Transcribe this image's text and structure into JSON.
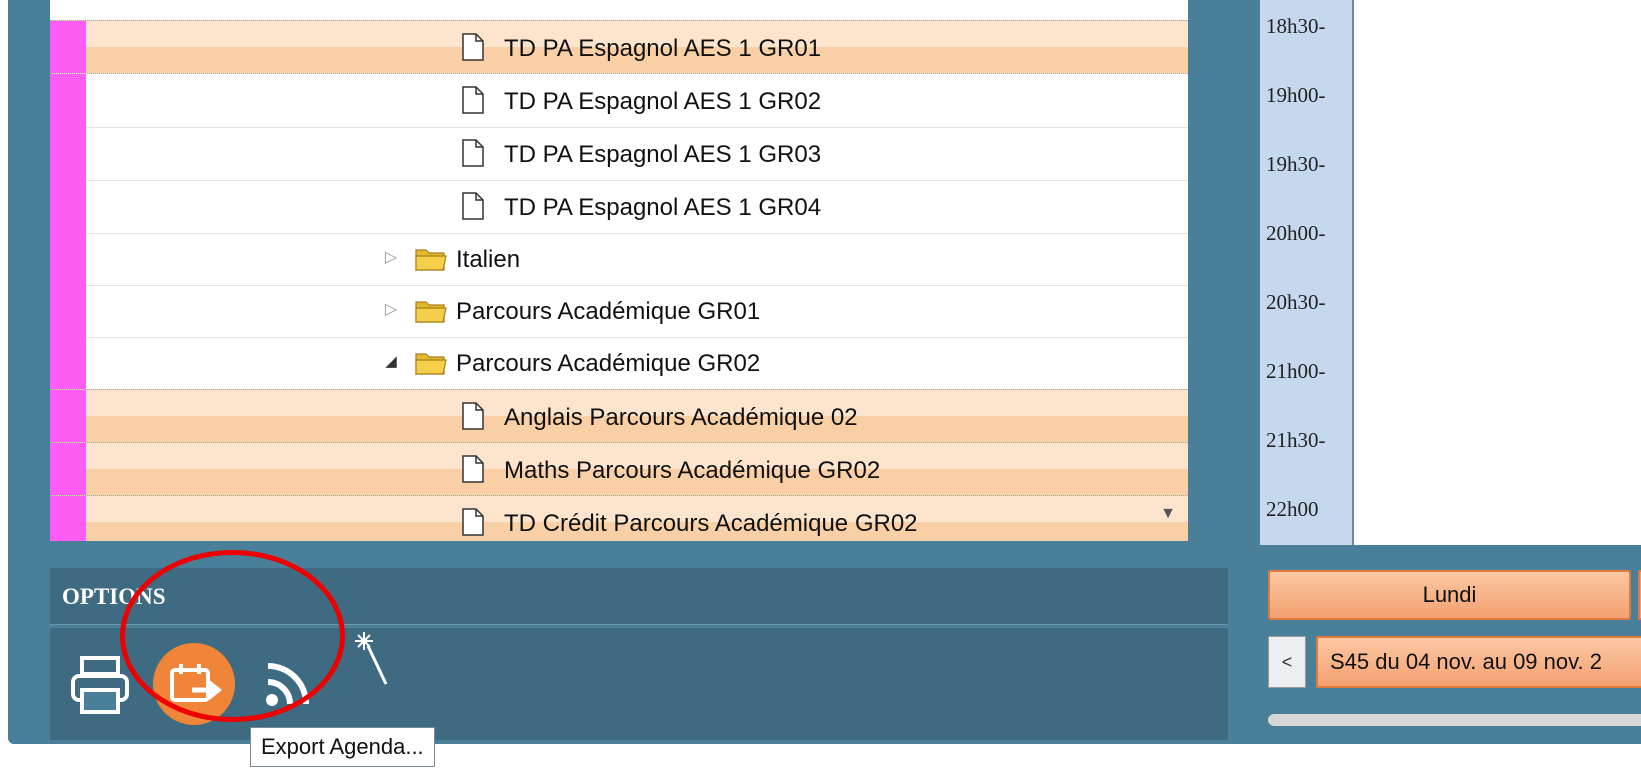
{
  "tree": {
    "rows": [
      {
        "label": "TD PA Espagnol AES 1 GR01",
        "type": "file",
        "selected": true
      },
      {
        "label": "TD PA Espagnol AES 1 GR02",
        "type": "file",
        "selected": false
      },
      {
        "label": "TD PA Espagnol AES 1 GR03",
        "type": "file",
        "selected": false
      },
      {
        "label": "TD PA Espagnol AES 1 GR04",
        "type": "file",
        "selected": false
      },
      {
        "label": "Italien",
        "type": "folder",
        "expanded": false
      },
      {
        "label": "Parcours Académique GR01",
        "type": "folder",
        "expanded": false
      },
      {
        "label": "Parcours Académique GR02",
        "type": "folder",
        "expanded": true
      },
      {
        "label": "Anglais Parcours Académique 02",
        "type": "file",
        "selected": true
      },
      {
        "label": "Maths Parcours Académique GR02",
        "type": "file",
        "selected": true
      },
      {
        "label": "TD Crédit Parcours Académique GR02",
        "type": "file",
        "selected": true
      }
    ]
  },
  "timeline": {
    "times": [
      "18h30-",
      "19h00-",
      "19h30-",
      "20h00-",
      "20h30-",
      "21h00-",
      "21h30-",
      "22h00"
    ]
  },
  "options": {
    "title": "OPTIONS",
    "tooltip": "Export Agenda...",
    "tools": [
      "print-icon",
      "calendar-export-icon",
      "rss-icon",
      "magic-wand-icon"
    ]
  },
  "calendar": {
    "day": "Lundi",
    "prev_label": "<",
    "week_label": "S45 du 04 nov. au 09 nov. 2"
  },
  "colors": {
    "app_bg": "#4a7f99",
    "selected_row": "#f9cfa6",
    "marker": "#ff5cf4",
    "accent_orange": "#f3a070",
    "annotation": "#e00000"
  }
}
